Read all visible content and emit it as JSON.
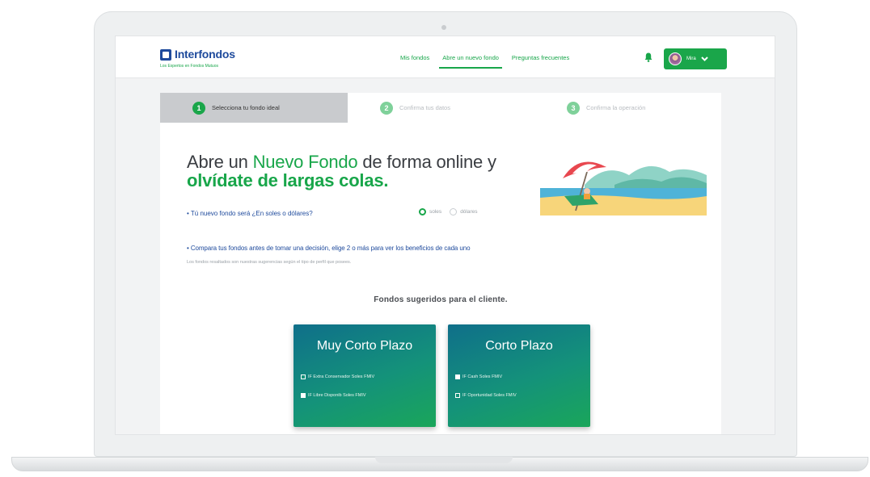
{
  "brand": {
    "name": "Interfondos",
    "tagline": "Los Expertos en Fondos Mutuos"
  },
  "nav": {
    "links": [
      {
        "label": "Mis fondos",
        "active": false
      },
      {
        "label": "Abre un nuevo fondo",
        "active": true
      },
      {
        "label": "Preguntas frecuentes",
        "active": false
      }
    ],
    "user_label": "Mira"
  },
  "steps": [
    {
      "num": "1",
      "label": "Selecciona tu fondo ideal",
      "active": true
    },
    {
      "num": "2",
      "label": "Confirma tus datos",
      "active": false
    },
    {
      "num": "3",
      "label": "Confirma la operación",
      "active": false
    }
  ],
  "headline": {
    "part1": "Abre un ",
    "highlight1": "Nuevo Fondo",
    "part2": " de forma online y",
    "highlight2": "olvídate de largas colas."
  },
  "currency": {
    "question": "• Tú nuevo fondo será ¿En soles o dólares?",
    "options": [
      "soles",
      "dólares"
    ],
    "selected": "soles"
  },
  "compare": {
    "text": "• Compara tus fondos antes de tomar una decisión, elige 2 o más para ver los beneficios de cada uno",
    "note": "Los fondos resaltados son nuestras sugerencias según el tipo de perfil que posees."
  },
  "suggested_title": "Fondos sugeridos para el cliente.",
  "cards": [
    {
      "title": "Muy Corto Plazo",
      "items": [
        {
          "label": "IF Extra Conservador Soles FMIV",
          "checked": true
        },
        {
          "label": "IF Libre Disponib Soles FMIV",
          "checked": false
        }
      ]
    },
    {
      "title": "Corto Plazo",
      "items": [
        {
          "label": "IF Cash Soles FMIV",
          "checked": false
        },
        {
          "label": "IF Oportunidad Soles FMIV",
          "checked": true
        }
      ]
    }
  ],
  "colors": {
    "brand_green": "#18a64a",
    "brand_blue": "#1e4a9c",
    "card_teal": "#0f6f8a"
  }
}
